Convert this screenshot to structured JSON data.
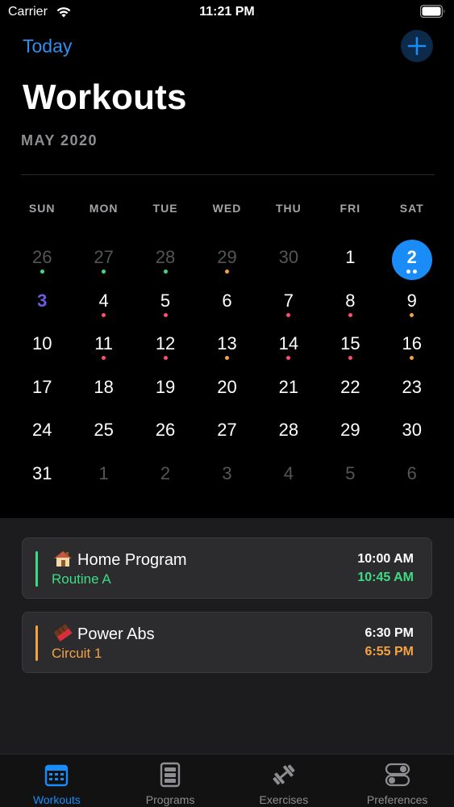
{
  "status_bar": {
    "carrier": "Carrier",
    "time": "11:21 PM",
    "wifi_icon": "wifi-icon",
    "battery_icon": "battery-icon"
  },
  "header": {
    "today_label": "Today",
    "add_icon": "plus-icon",
    "title": "Workouts",
    "month": "MAY 2020"
  },
  "colors": {
    "accent": "#1a8cf7",
    "green": "#3ddc84",
    "orange": "#f5a243",
    "red": "#ff4d6d",
    "today": "#6b5ce0"
  },
  "weekdays": [
    "SUN",
    "MON",
    "TUE",
    "WED",
    "THU",
    "FRI",
    "SAT"
  ],
  "calendar": {
    "weeks": [
      [
        {
          "day": "26",
          "muted": true,
          "dots": [
            "green"
          ]
        },
        {
          "day": "27",
          "muted": true,
          "dots": [
            "green"
          ]
        },
        {
          "day": "28",
          "muted": true,
          "dots": [
            "green"
          ]
        },
        {
          "day": "29",
          "muted": true,
          "dots": [
            "orange"
          ]
        },
        {
          "day": "30",
          "muted": true,
          "dots": []
        },
        {
          "day": "1",
          "dots": []
        },
        {
          "day": "2",
          "selected": true,
          "dots": [
            "white",
            "white"
          ]
        }
      ],
      [
        {
          "day": "3",
          "today": true,
          "dots": []
        },
        {
          "day": "4",
          "dots": [
            "red"
          ]
        },
        {
          "day": "5",
          "dots": [
            "red"
          ]
        },
        {
          "day": "6",
          "dots": []
        },
        {
          "day": "7",
          "dots": [
            "red"
          ]
        },
        {
          "day": "8",
          "dots": [
            "red"
          ]
        },
        {
          "day": "9",
          "dots": [
            "orange"
          ]
        }
      ],
      [
        {
          "day": "10",
          "dots": []
        },
        {
          "day": "11",
          "dots": [
            "red"
          ]
        },
        {
          "day": "12",
          "dots": [
            "red"
          ]
        },
        {
          "day": "13",
          "dots": [
            "orange"
          ]
        },
        {
          "day": "14",
          "dots": [
            "red"
          ]
        },
        {
          "day": "15",
          "dots": [
            "red"
          ]
        },
        {
          "day": "16",
          "dots": [
            "orange"
          ]
        }
      ],
      [
        {
          "day": "17",
          "dots": []
        },
        {
          "day": "18",
          "dots": []
        },
        {
          "day": "19",
          "dots": []
        },
        {
          "day": "20",
          "dots": []
        },
        {
          "day": "21",
          "dots": []
        },
        {
          "day": "22",
          "dots": []
        },
        {
          "day": "23",
          "dots": []
        }
      ],
      [
        {
          "day": "24",
          "dots": []
        },
        {
          "day": "25",
          "dots": []
        },
        {
          "day": "26",
          "dots": []
        },
        {
          "day": "27",
          "dots": []
        },
        {
          "day": "28",
          "dots": []
        },
        {
          "day": "29",
          "dots": []
        },
        {
          "day": "30",
          "dots": []
        }
      ],
      [
        {
          "day": "31",
          "dots": []
        },
        {
          "day": "1",
          "muted": true,
          "dots": []
        },
        {
          "day": "2",
          "muted": true,
          "dots": []
        },
        {
          "day": "3",
          "muted": true,
          "dots": []
        },
        {
          "day": "4",
          "muted": true,
          "dots": []
        },
        {
          "day": "5",
          "muted": true,
          "dots": []
        },
        {
          "day": "6",
          "muted": true,
          "dots": []
        }
      ]
    ]
  },
  "events": [
    {
      "icon": "house-icon",
      "title": "Home Program",
      "subtitle": "Routine A",
      "start": "10:00 AM",
      "end": "10:45 AM",
      "color": "#3ddc84"
    },
    {
      "icon": "chocolate-bar-icon",
      "title": "Power Abs",
      "subtitle": "Circuit 1",
      "start": "6:30 PM",
      "end": "6:55 PM",
      "color": "#f5a243"
    }
  ],
  "tabs": [
    {
      "label": "Workouts",
      "icon": "calendar-icon",
      "active": true
    },
    {
      "label": "Programs",
      "icon": "programs-icon",
      "active": false
    },
    {
      "label": "Exercises",
      "icon": "dumbbell-icon",
      "active": false
    },
    {
      "label": "Preferences",
      "icon": "toggles-icon",
      "active": false
    }
  ]
}
